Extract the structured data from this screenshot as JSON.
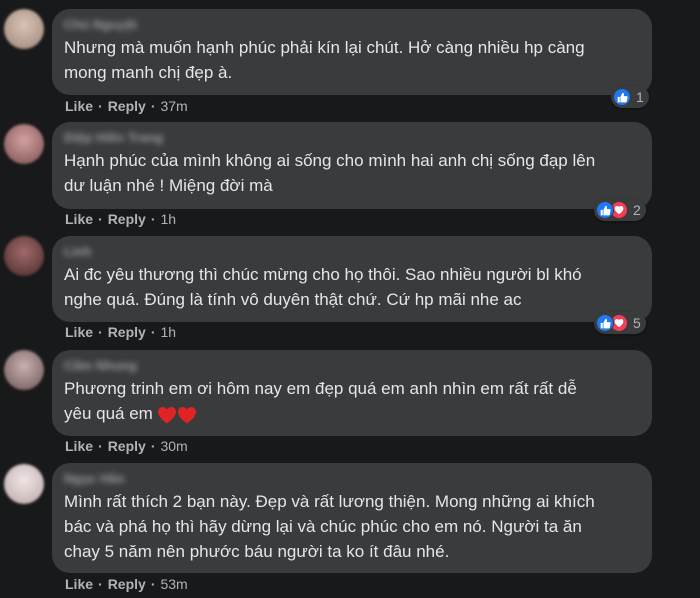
{
  "comments": [
    {
      "author": "Chú Nguyệt",
      "text": "Nhưng mà muốn hạnh phúc phải kín lại chút. Hở càng nhiều hp càng\nmong manh chị đẹp à.",
      "like": "Like",
      "reply": "Reply",
      "time": "37m",
      "reactions": [
        "like"
      ],
      "reaction_count": "1",
      "avatar_color": "#c9b4a8"
    },
    {
      "author": "Diệp Hiền Trang",
      "text": "Hạnh phúc của mình không ai sống cho mình hai anh chị sống đạp lên\ndư luận nhé ! Miệng đời mà",
      "like": "Like",
      "reply": "Reply",
      "time": "1h",
      "reactions": [
        "like",
        "love"
      ],
      "reaction_count": "2",
      "avatar_color": "#b07d7d"
    },
    {
      "author": "Linh",
      "text": "Ai đc yêu thương thì chúc mừng cho họ thôi. Sao nhiều người bl khó\nnghe quá. Đúng là tính vô duyên thật chứ. Cứ hp mãi nhe ac",
      "like": "Like",
      "reply": "Reply",
      "time": "1h",
      "reactions": [
        "like",
        "love"
      ],
      "reaction_count": "5",
      "avatar_color": "#8b5a5a"
    },
    {
      "author": "Cẩm Nhung",
      "text": "Phương trinh em ơi hôm nay em đẹp quá em anh nhìn em rất rất dễ\nyêu quá em",
      "like": "Like",
      "reply": "Reply",
      "time": "30m",
      "reactions": [],
      "reaction_count": "",
      "avatar_color": "#a58c8c"
    },
    {
      "author": "Ngọc Hân",
      "text": "Mình rất thích 2 bạn này. Đẹp và rất lương thiện. Mong những ai khích\nbác và phá họ thì hãy dừng lại và chúc phúc cho em nó. Người ta ăn\nchay 5 năm nên phước báu người ta ko ít đâu nhé.",
      "like": "Like",
      "reply": "Reply",
      "time": "53m",
      "reactions": [],
      "reaction_count": "",
      "avatar_color": "#d9cfcf"
    }
  ],
  "colors": {
    "background": "#18191a",
    "bubble": "#3a3b3c",
    "like_blue": "#2078f4",
    "love_red": "#f33e58",
    "secondary_text": "#b0b3b8"
  }
}
